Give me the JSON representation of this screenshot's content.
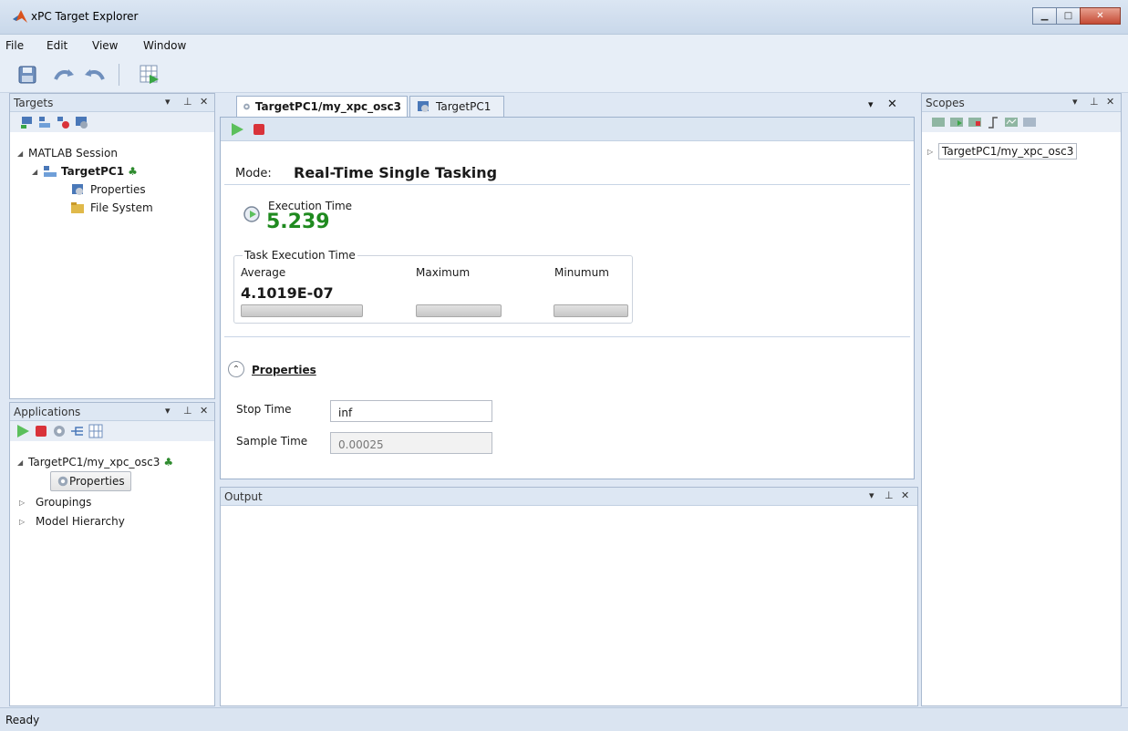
{
  "window": {
    "title": "xPC Target Explorer"
  },
  "menu": [
    "File",
    "Edit",
    "View",
    "Window"
  ],
  "targets_panel": {
    "title": "Targets",
    "tree": {
      "session": "MATLAB Session",
      "target": "TargetPC1",
      "children": [
        "Properties",
        "File System"
      ]
    }
  },
  "applications_panel": {
    "title": "Applications",
    "tree": {
      "app": "TargetPC1/my_xpc_osc3",
      "properties_button": "Properties",
      "children": [
        "Groupings",
        "Model Hierarchy"
      ]
    }
  },
  "tabs": [
    "TargetPC1/my_xpc_osc3",
    "TargetPC1"
  ],
  "main": {
    "mode_label": "Mode:",
    "mode_value": "Real-Time Single Tasking",
    "execution_time_label": "Execution Time",
    "execution_time_value": "5.239",
    "task_group_label": "Task Execution Time",
    "average_label": "Average",
    "maximum_label": "Maximum",
    "minimum_label": "Minumum",
    "average_value": "4.1019E-07",
    "properties_header": "Properties",
    "stop_time_label": "Stop Time",
    "stop_time_value": "inf",
    "sample_time_label": "Sample Time",
    "sample_time_value": "0.00025"
  },
  "output_panel": {
    "title": "Output"
  },
  "scopes_panel": {
    "title": "Scopes",
    "tree": {
      "item": "TargetPC1/my_xpc_osc3"
    }
  },
  "status": {
    "text": "Ready"
  },
  "colors": {
    "accent": "#1f8a1f",
    "stop": "#d9333a",
    "play": "#4caf50"
  }
}
